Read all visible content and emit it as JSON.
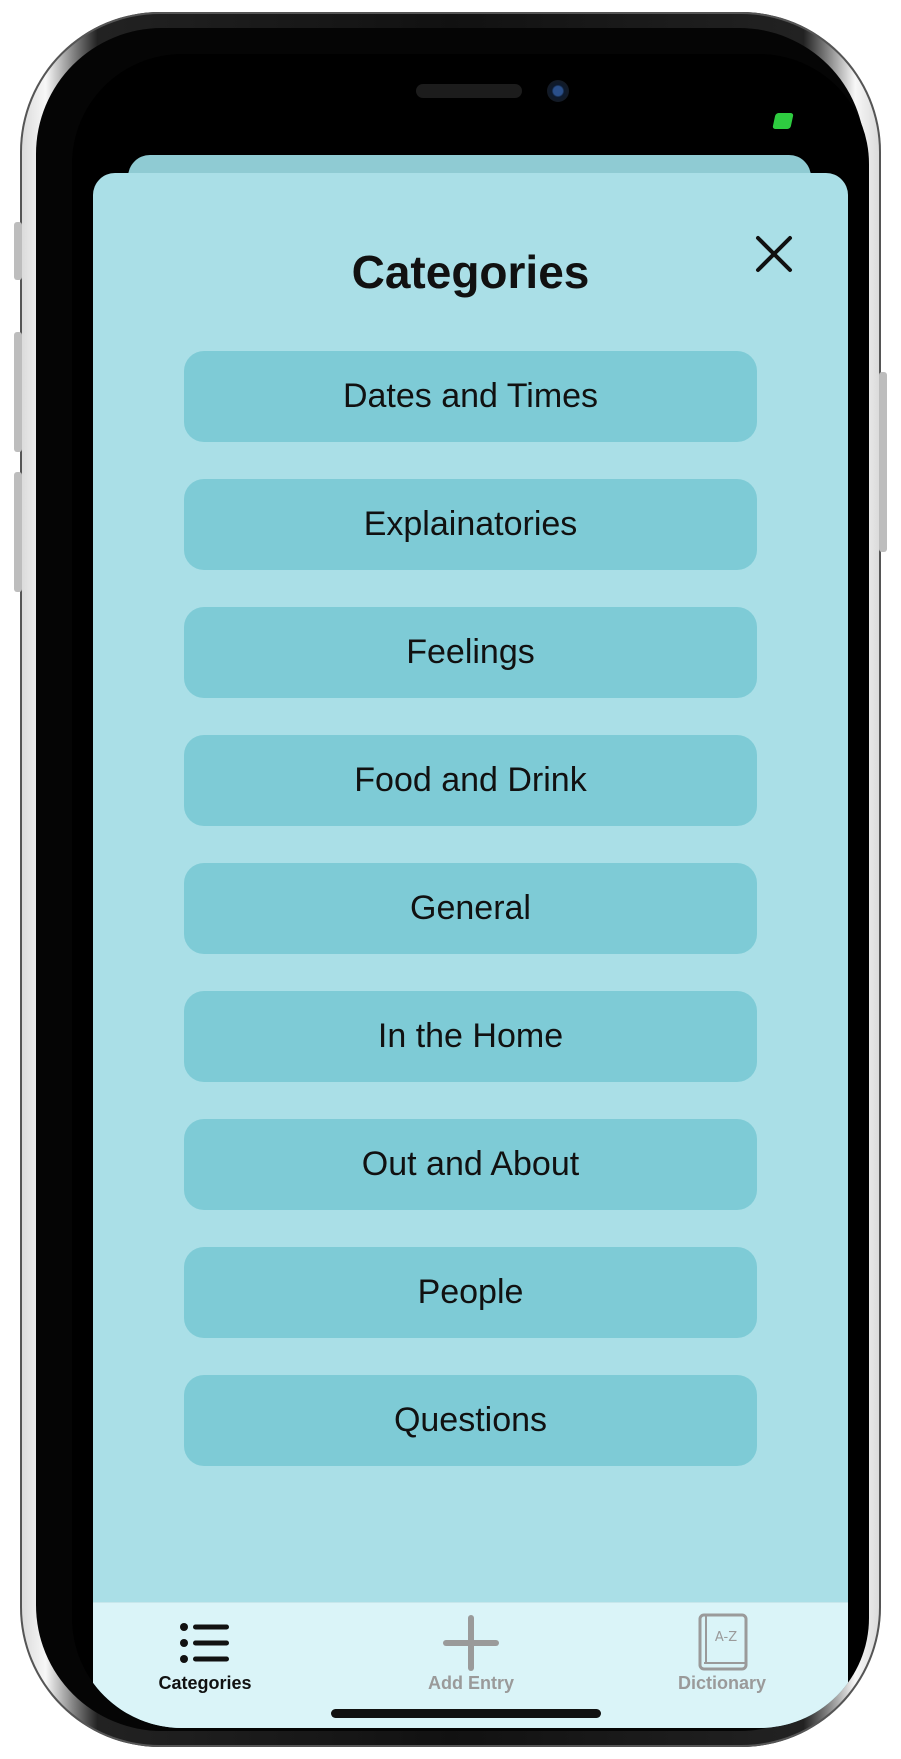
{
  "sheet": {
    "title": "Categories",
    "close_icon": "close-icon"
  },
  "categories": [
    {
      "label": "Dates and Times"
    },
    {
      "label": "Explainatories"
    },
    {
      "label": "Feelings"
    },
    {
      "label": "Food and Drink"
    },
    {
      "label": "General"
    },
    {
      "label": "In the Home"
    },
    {
      "label": "Out and About"
    },
    {
      "label": "People"
    },
    {
      "label": "Questions"
    }
  ],
  "tabbar": {
    "tabs": [
      {
        "label": "Categories",
        "icon": "list-icon",
        "active": true
      },
      {
        "label": "Add Entry",
        "icon": "plus-icon",
        "active": false
      },
      {
        "label": "Dictionary",
        "icon": "dictionary-icon",
        "active": false
      }
    ],
    "dictionary_icon_text": "A-Z"
  },
  "colors": {
    "sheet_background": "#aadfe7",
    "button_background": "#7ecbd6",
    "tabbar_background": "#daf4f8",
    "battery": "#2ecc40"
  }
}
